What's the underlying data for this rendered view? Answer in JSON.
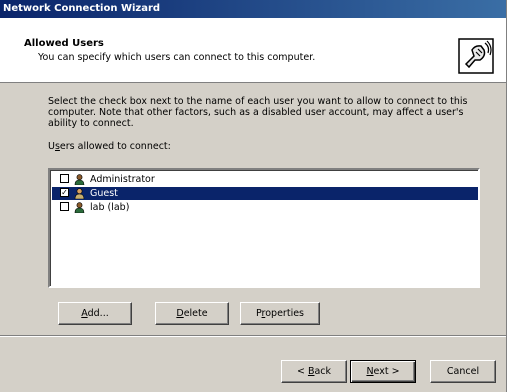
{
  "window": {
    "title": "Network Connection Wizard"
  },
  "header": {
    "title": "Allowed Users",
    "subtitle": "You can specify which users can connect to this computer.",
    "icon": "network-wizard-icon"
  },
  "instructions": "Select the check box next to the name of each user you want to allow to connect to this computer.  Note that other factors, such as a disabled user account, may affect a user's ability to connect.",
  "users_label": {
    "prefix": "U",
    "underlined": "s",
    "suffix": "ers allowed to connect:"
  },
  "users": [
    {
      "name": "Administrator",
      "checked": false,
      "selected": false
    },
    {
      "name": "Guest",
      "checked": true,
      "selected": true
    },
    {
      "name": "lab (lab)",
      "checked": false,
      "selected": false
    }
  ],
  "list_buttons": {
    "add": {
      "prefix": "",
      "underlined": "A",
      "suffix": "dd..."
    },
    "delete": {
      "prefix": "",
      "underlined": "D",
      "suffix": "elete"
    },
    "properties": {
      "prefix": "P",
      "underlined": "r",
      "suffix": "operties"
    }
  },
  "nav_buttons": {
    "back": {
      "prefix": "< ",
      "underlined": "B",
      "suffix": "ack"
    },
    "next": {
      "prefix": "",
      "underlined": "N",
      "suffix": "ext >"
    },
    "cancel": {
      "label": "Cancel"
    }
  },
  "colors": {
    "title_gradient_start": "#0a246a",
    "title_gradient_end": "#3a6ea5",
    "selection": "#0a246a",
    "dialog_face": "#d4d0c8"
  }
}
